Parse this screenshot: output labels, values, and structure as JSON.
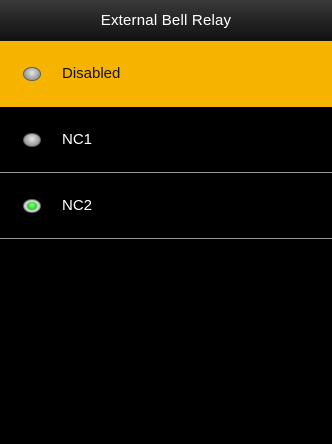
{
  "header": {
    "title": "External Bell Relay"
  },
  "options": [
    {
      "label": "Disabled",
      "checked": false,
      "highlighted": true
    },
    {
      "label": "NC1",
      "checked": false,
      "highlighted": false
    },
    {
      "label": "NC2",
      "checked": true,
      "highlighted": false
    }
  ],
  "colors": {
    "highlight": "#f6b300",
    "background": "#000000",
    "radio_checked": "#2ee02e"
  }
}
